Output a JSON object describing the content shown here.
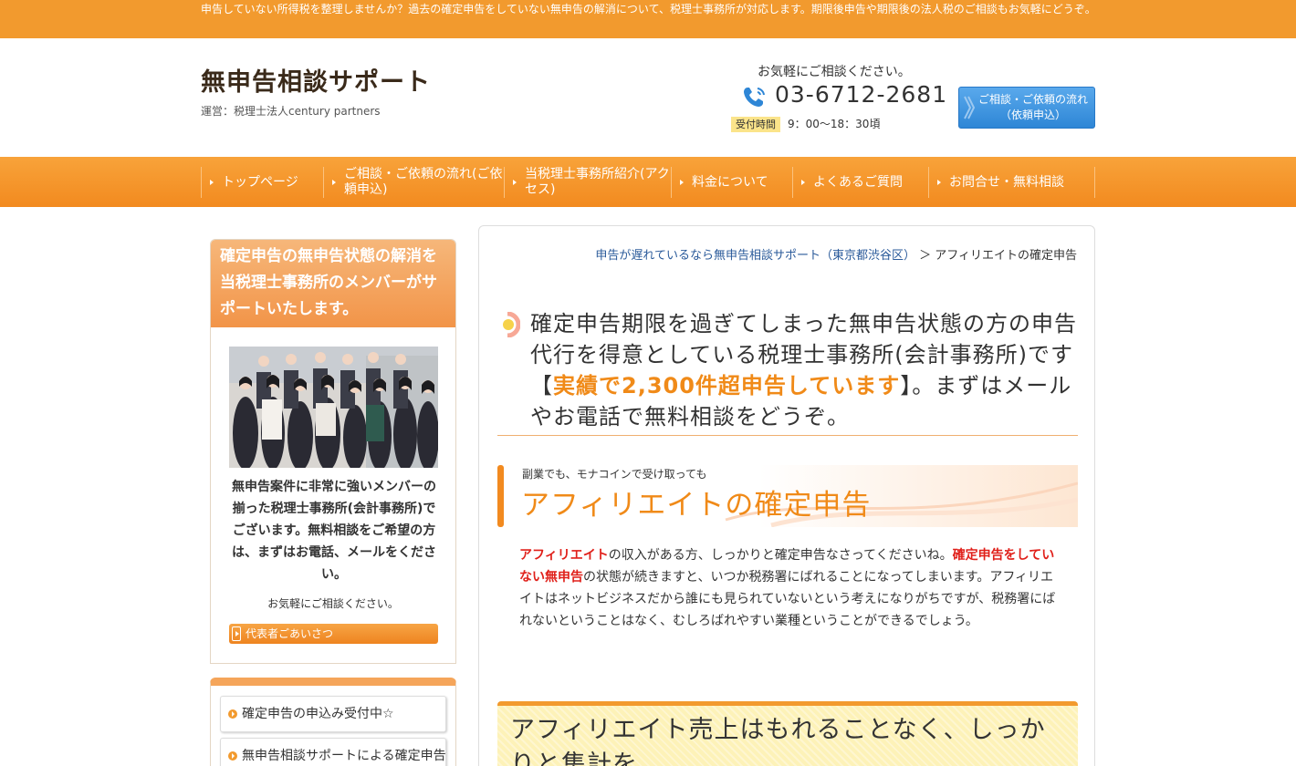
{
  "topbar": {
    "text": "申告していない所得税を整理しませんか？過去の確定申告をしていない無申告の解消について、税理士事務所が対応します。期限後申告や期限後の法人税のご相談もお気軽にどうぞ。"
  },
  "header": {
    "site_title": "無申告相談サポート",
    "operator": "運営：税理士法人century partners",
    "contact_note": "お気軽にご相談ください。",
    "phone": "03-6712-2681",
    "hours_label": "受付時間",
    "hours": "9：00〜18：30頃",
    "cta_label": "ご相談・ご依頼の流れ（依頼申込）"
  },
  "nav": {
    "items": [
      {
        "label": "トップページ"
      },
      {
        "label": "ご相談・ご依頼の流れ(ご依頼申込)"
      },
      {
        "label": "当税理士事務所紹介(アクセス)"
      },
      {
        "label": "料金について"
      },
      {
        "label": "よくあるご質問"
      },
      {
        "label": "お問合せ・無料相談"
      }
    ]
  },
  "sidebar": {
    "heading": "確定申告の無申告状態の解消を当税理士事務所のメンバーがサポートいたします。",
    "description": "無申告案件に非常に強いメンバーの揃った税理士事務所(会計事務所)でございます。無料相談をご希望の方は、まずはお電話、メールをください。",
    "note": "お気軽にご相談ください。",
    "button_label": "代表者ごあいさつ",
    "menu": [
      {
        "label": "確定申告の申込み受付中☆"
      },
      {
        "label": "無申告相談サポートによる確定申告"
      }
    ]
  },
  "main": {
    "breadcrumb": {
      "home": "申告が遅れているなら無申告相談サポート（東京都渋谷区）",
      "separator": "＞",
      "current": "アフィリエイトの確定申告"
    },
    "lead": {
      "before": "確定申告期限を過ぎてしまった無申告状態の方の申告代行を得意としている税理士事務所(会計事務所)です【",
      "highlight": "実績で2,300件超申告しています",
      "after": "】。まずはメールやお電話で無料相談をどうぞ。"
    },
    "section": {
      "kicker": "副業でも、モナコインで受け取っても",
      "title": "アフィリエイトの確定申告"
    },
    "body": {
      "red1": "アフィリエイト",
      "text1": "の収入がある方、しっかりと確定申告なさってくださいね。",
      "red2": "確定申告をしていない無申告",
      "text2": "の状態が続きますと、いつか税務署にばれることになってしまいます。アフィリエイトはネットビジネスだから誰にも見られていないという考えになりがちですが、税務署にばれないということはなく、むしろばれやすい業種ということができるでしょう。"
    },
    "callout": "アフィリエイト売上はもれることなく、しっかりと集計を"
  },
  "colors": {
    "accent": "#f29a2e",
    "highlight_text": "#f08a18",
    "alert_red": "#e0201a",
    "cta_blue": "#2e86d6",
    "callout_bg": "#fdf2b8"
  }
}
